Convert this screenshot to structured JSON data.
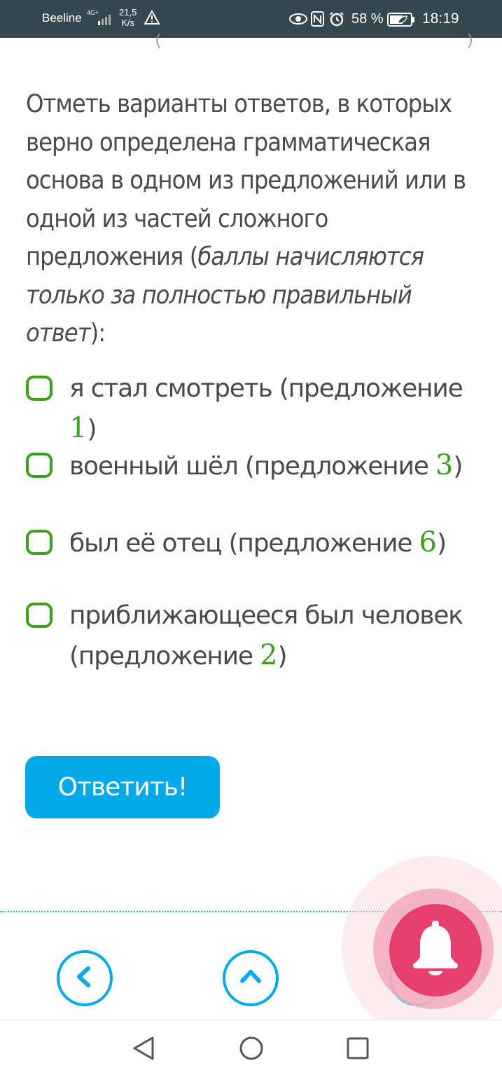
{
  "status_bar": {
    "carrier": "Beeline",
    "network": "4G+",
    "speed_value": "21,5",
    "speed_unit": "K/s",
    "battery": "58 %",
    "time": "18:19"
  },
  "quiz": {
    "question_main": "Отметь варианты ответов, в которых верно определена грамматическая основа в одном из предложений или в одной из частей сложного предложения (",
    "question_italic_1": "баллы начисляются только за полностью правильный ответ",
    "question_end": "):",
    "options": [
      {
        "text": "я стал смотреть (предложение ",
        "number": "1",
        "close": ")",
        "checked": false
      },
      {
        "text": "военный шёл (предложение ",
        "number": "3",
        "close": ")",
        "checked": false
      },
      {
        "text": "был её отец (предложение ",
        "number": "6",
        "close": ")",
        "checked": false
      },
      {
        "text": "приближающееся был человек (предложение ",
        "number": "2",
        "close": ")",
        "checked": false
      }
    ],
    "submit_label": "Ответить!"
  },
  "fragment": {
    "left": "(",
    "right": ")"
  },
  "colors": {
    "status_bar": "#37474f",
    "accent_blue": "#03a9e8",
    "checkbox_green": "#3aa21b",
    "bell_red": "#e63e6d"
  },
  "icons": {
    "back": "chevron-left-icon",
    "up": "chevron-up-icon",
    "notify": "bell-icon",
    "system_back": "triangle-back-icon",
    "system_home": "circle-home-icon",
    "system_recent": "square-recent-icon"
  }
}
